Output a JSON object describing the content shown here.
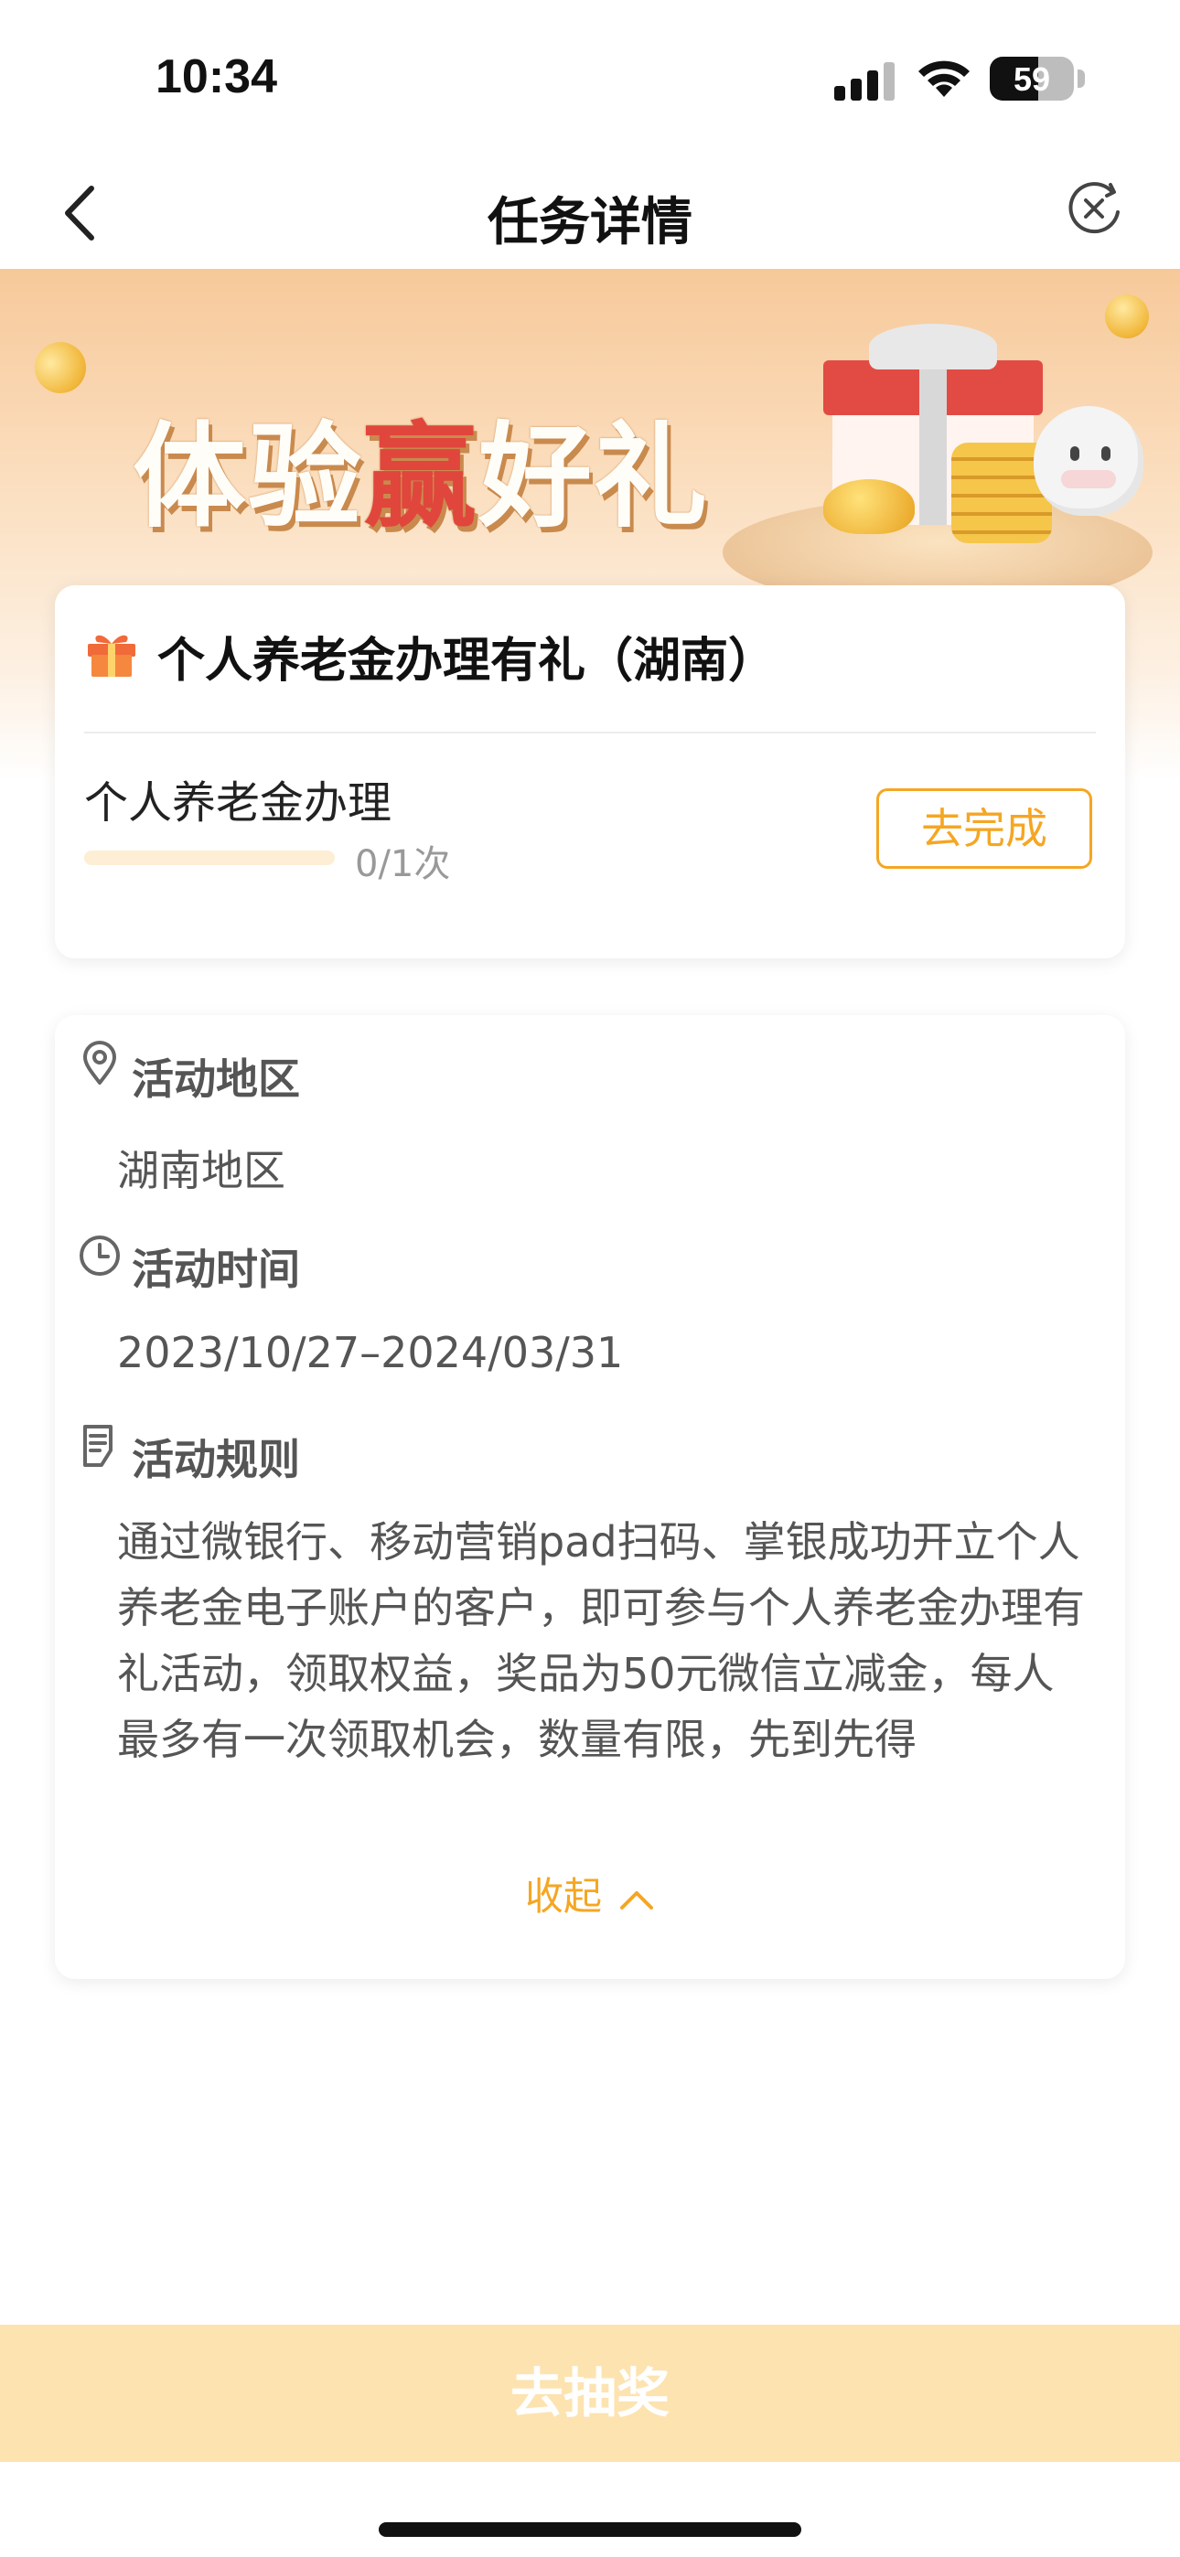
{
  "status_bar": {
    "time": "10:34",
    "battery": "59"
  },
  "nav": {
    "title": "任务详情"
  },
  "banner": {
    "title_prefix": "体验",
    "title_highlight": "赢",
    "title_suffix": "好礼"
  },
  "task": {
    "title": "个人养老金办理有礼（湖南）",
    "item_name": "个人养老金办理",
    "progress_text": "0/1次",
    "progress_value": 0,
    "action_label": "去完成"
  },
  "info": {
    "region_title": "活动地区",
    "region_value": "湖南地区",
    "time_title": "活动时间",
    "time_value": "2023/10/27–2024/03/31",
    "rules_title": "活动规则",
    "rules_text": "通过微银行、移动营销pad扫码、掌银成功开立个人养老金电子账户的客户，即可参与个人养老金办理有礼活动，领取权益，奖品为50元微信立减金，每人最多有一次领取机会，数量有限，先到先得",
    "collapse_label": "收起"
  },
  "bottom": {
    "lottery_label": "去抽奖"
  },
  "colors": {
    "accent": "#f5a623",
    "lottery_bg": "#fde3b0",
    "highlight_red": "#e0463c"
  }
}
